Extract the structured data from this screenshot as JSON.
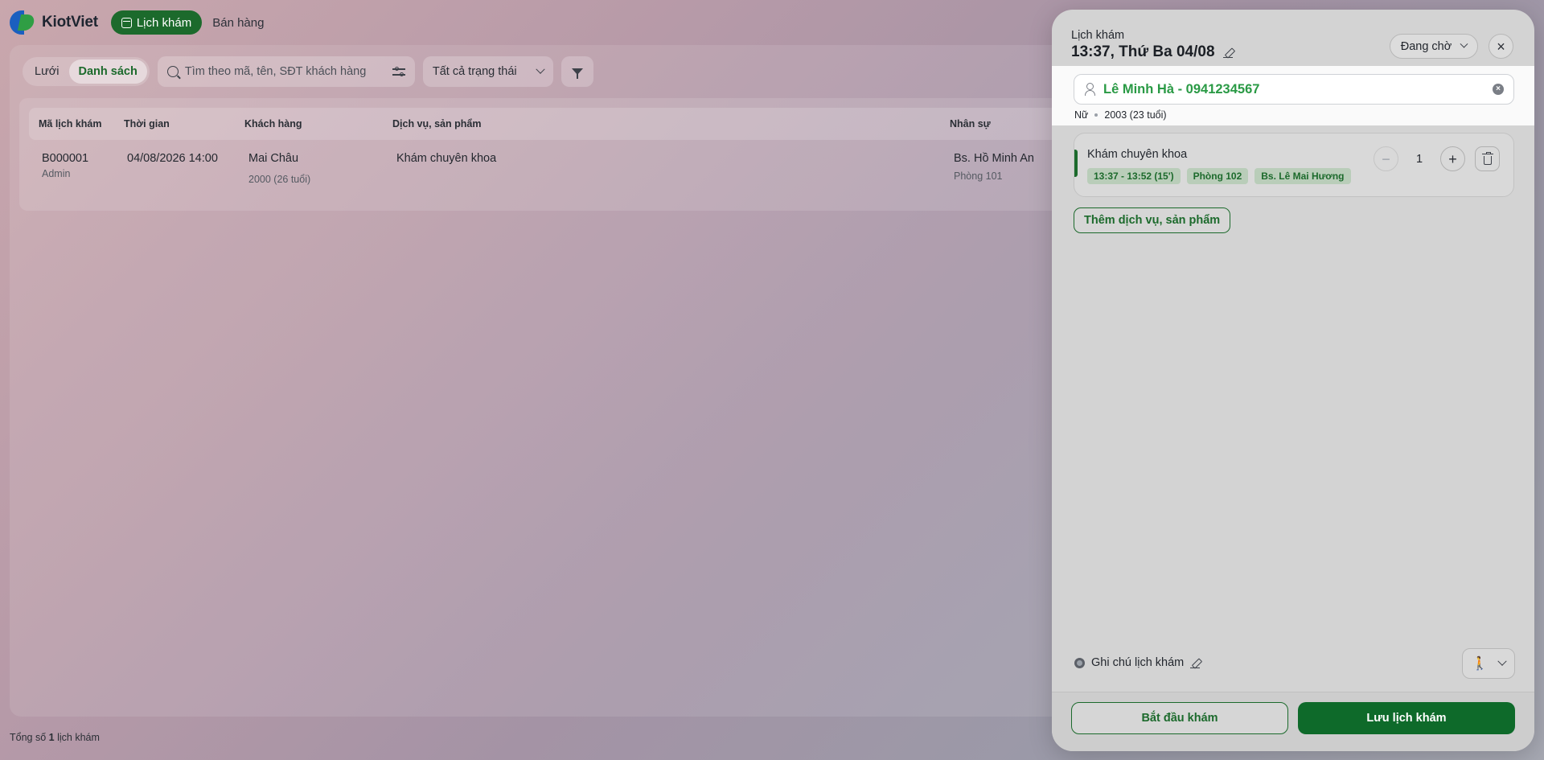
{
  "app": {
    "logo_text": "KiotViet",
    "nav": [
      {
        "label": "Lịch khám",
        "active": true
      },
      {
        "label": "Bán hàng",
        "active": false
      }
    ]
  },
  "toolbar": {
    "view_options": [
      {
        "label": "Lưới",
        "active": false
      },
      {
        "label": "Danh sách",
        "active": true
      }
    ],
    "search_placeholder": "Tìm theo mã, tên, SĐT khách hàng",
    "status_filter": "Tất cả trạng thái"
  },
  "table": {
    "columns": [
      "Mã lịch khám",
      "Thời gian",
      "Khách hàng",
      "Dịch vụ, sản phẩm",
      "Nhân sự"
    ],
    "rows": [
      {
        "code": "B000001",
        "creator": "Admin",
        "time": "04/08/2026 14:00",
        "customer": "Mai Châu",
        "customer_meta": "2000 (26 tuổi)",
        "service": "Khám chuyên khoa",
        "staff": "Bs. Hồ Minh An",
        "room": "Phòng 101"
      }
    ]
  },
  "footer": {
    "total_prefix": "Tổng số",
    "total_count": "1",
    "total_suffix": "lịch khám"
  },
  "drawer": {
    "label": "Lịch khám",
    "title": "13:37, Thứ Ba 04/08",
    "status": "Đang chờ",
    "customer": {
      "name": "Lê Minh Hà - 0941234567",
      "gender": "Nữ",
      "birth": "2003 (23 tuổi)"
    },
    "service": {
      "name": "Khám chuyên khoa",
      "time": "13:37 - 13:52 (15')",
      "room": "Phòng 102",
      "doctor": "Bs. Lê Mai Hương",
      "quantity": "1"
    },
    "add_service_label": "Thêm dịch vụ, sản phẩm",
    "note_label": "Ghi chú lịch khám",
    "buttons": {
      "start": "Bắt đầu khám",
      "save": "Lưu lịch khám"
    }
  },
  "colors": {
    "brand_green": "#1c6a2c",
    "customer_green": "#2a9a45",
    "logo_blue": "#1a5fbf"
  }
}
